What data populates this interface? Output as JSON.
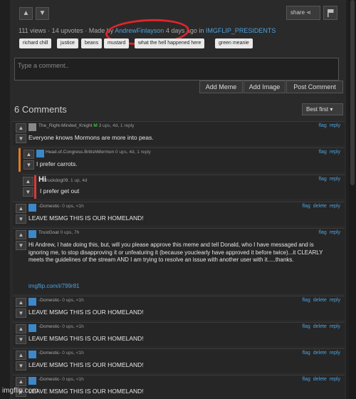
{
  "post": {
    "stats_prefix": "111 views · 14 upvotes · Made by",
    "author": "AndrewFinlayson",
    "stats_mid": "4 days ago in",
    "stream": "IMGFLIP_PRESIDENTS",
    "share_label": "share",
    "tags": [
      "richard chill",
      "justice",
      "beans",
      "mustard",
      "what the hell happened here",
      "green meanie"
    ]
  },
  "comment_form": {
    "placeholder": "Type a comment..",
    "buttons": [
      "Add Meme",
      "Add Image",
      "Post Comment"
    ]
  },
  "comments_header": {
    "count": "6 Comments",
    "sort": "Best first"
  },
  "comments": [
    {
      "user": "The_Right-Minded_Knight",
      "badge": "M",
      "meta": "3 ups, 4d, 1 reply",
      "text": "Everyone knows Mormons are more into peas.",
      "links": [
        "flag",
        "reply"
      ]
    },
    {
      "user": "Head.of.Congress.BritishMormon",
      "meta": "0 ups, 4d, 1 reply",
      "text": "I prefer carrots.",
      "links": [
        "flag",
        "reply"
      ]
    },
    {
      "user": "Hi",
      "user_rest": "ruckdog09.",
      "meta": "1 up, 4d",
      "text": "I prefer get out",
      "links": [
        "flag",
        "reply"
      ]
    },
    {
      "user": "-Domestic-",
      "meta": "0 ups, <1h",
      "text": "LEAVE MSMG THIS IS OUR HOMELAND!",
      "links": [
        "flag",
        "delete",
        "reply"
      ]
    },
    {
      "user": "TrustGoat",
      "meta": "0 ups, 7h",
      "text": "Hi Andrew, I hate doing this, but, will you please approve this meme and tell Donald, who I have messaged and is ignoring me, to stop disapproving it or unfeaturing it (because youclearly have approved it before twice)...it CLEARLY meets the guidelines of the stream AND I am trying to resolve an issue with another user with it.....thanks.",
      "link": "imgflip.com/i/799r81",
      "links": [
        "flag",
        "reply"
      ]
    },
    {
      "user": "-Domestic-",
      "meta": "0 ups, <1h",
      "text": "LEAVE MSMG THIS IS OUR HOMELAND!",
      "links": [
        "flag",
        "delete",
        "reply"
      ]
    },
    {
      "user": "-Domestic-",
      "meta": "0 ups, <1h",
      "text": "LEAVE MSMG THIS IS OUR HOMELAND!",
      "links": [
        "flag",
        "delete",
        "reply"
      ]
    },
    {
      "user": "-Domestic-",
      "meta": "0 ups, <1h",
      "text": "LEAVE MSMG THIS IS OUR HOMELAND!",
      "links": [
        "flag",
        "delete",
        "reply"
      ]
    },
    {
      "user": "-Domestic-",
      "meta": "0 ups, <1h",
      "text": "LEAVE MSMG THIS IS OUR HOMELAND!",
      "links": [
        "flag",
        "delete",
        "reply"
      ]
    }
  ],
  "watermark": "imgflip.com",
  "colors": {
    "accent": "#4aa3e0",
    "annotation": "#e0242c",
    "background": "#2a2a2a"
  }
}
